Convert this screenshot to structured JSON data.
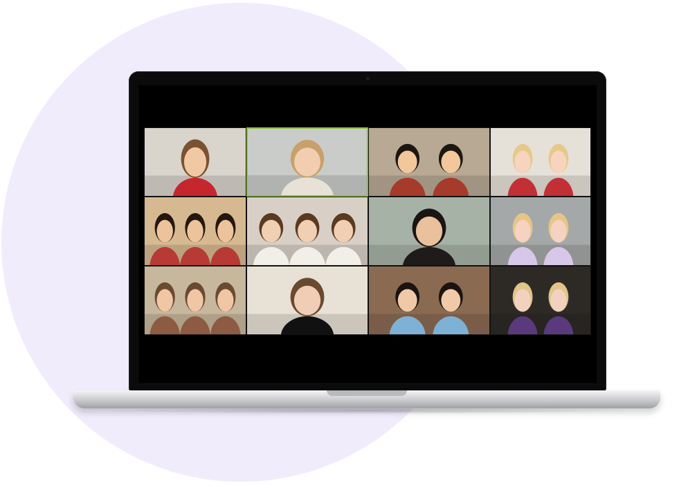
{
  "colors": {
    "background_circle": "#f1ecfb",
    "active_speaker_border": "#8bbd3b",
    "screen": "#000000"
  },
  "video_grid": {
    "rows": 3,
    "columns": 4,
    "active_speaker_index": 1,
    "tiles": [
      {
        "name": "participant-tile-1",
        "icon": "boy-red-hoodie",
        "bg": "#d9d4cc",
        "shirt": "#c6262e",
        "skin": "#f0c8a4",
        "hair": "#7a5232"
      },
      {
        "name": "participant-tile-2",
        "icon": "teacher-glasses",
        "bg": "#c9ccc9",
        "shirt": "#e8e2d6",
        "skin": "#f2cdb0",
        "hair": "#c8a06a"
      },
      {
        "name": "participant-tile-3",
        "icon": "two-kids",
        "bg": "#b8a994",
        "shirt": "#a63b2b",
        "skin": "#f1c79b",
        "hair": "#1d1712"
      },
      {
        "name": "participant-tile-4",
        "icon": "two-toddlers",
        "bg": "#e6e1d8",
        "shirt": "#c22f35",
        "skin": "#f6d4be",
        "hair": "#e6c98a"
      },
      {
        "name": "participant-tile-5",
        "icon": "three-kids",
        "bg": "#d7b991",
        "shirt": "#b83a35",
        "skin": "#edc39c",
        "hair": "#24170f"
      },
      {
        "name": "participant-tile-6",
        "icon": "three-kids-sofa",
        "bg": "#d8d0c6",
        "shirt": "#f2efe9",
        "skin": "#f1cfb3",
        "hair": "#5b3a22"
      },
      {
        "name": "participant-tile-7",
        "icon": "girl-glasses",
        "bg": "#a7b2a6",
        "shirt": "#1f1b1b",
        "skin": "#e9c19c",
        "hair": "#1a1412"
      },
      {
        "name": "participant-tile-8",
        "icon": "two-girls",
        "bg": "#a5a8a8",
        "shirt": "#d7c7e8",
        "skin": "#f5d2c2",
        "hair": "#e6c685"
      },
      {
        "name": "participant-tile-9",
        "icon": "family-group",
        "bg": "#c7b79d",
        "shirt": "#8d5a42",
        "skin": "#f0c6a5",
        "hair": "#6a4a30"
      },
      {
        "name": "participant-tile-10",
        "icon": "girl-blue-glasses",
        "bg": "#e8e1d6",
        "shirt": "#111111",
        "skin": "#f0cdb5",
        "hair": "#6a4a2e"
      },
      {
        "name": "participant-tile-11",
        "icon": "two-sisters",
        "bg": "#8b6a52",
        "shirt": "#7db2d6",
        "skin": "#f0c9a9",
        "hair": "#1a1310"
      },
      {
        "name": "participant-tile-12",
        "icon": "two-girls-kitchen",
        "bg": "#2d2a26",
        "shirt": "#5a3a7c",
        "skin": "#f2d2bf",
        "hair": "#e2c488"
      }
    ]
  }
}
